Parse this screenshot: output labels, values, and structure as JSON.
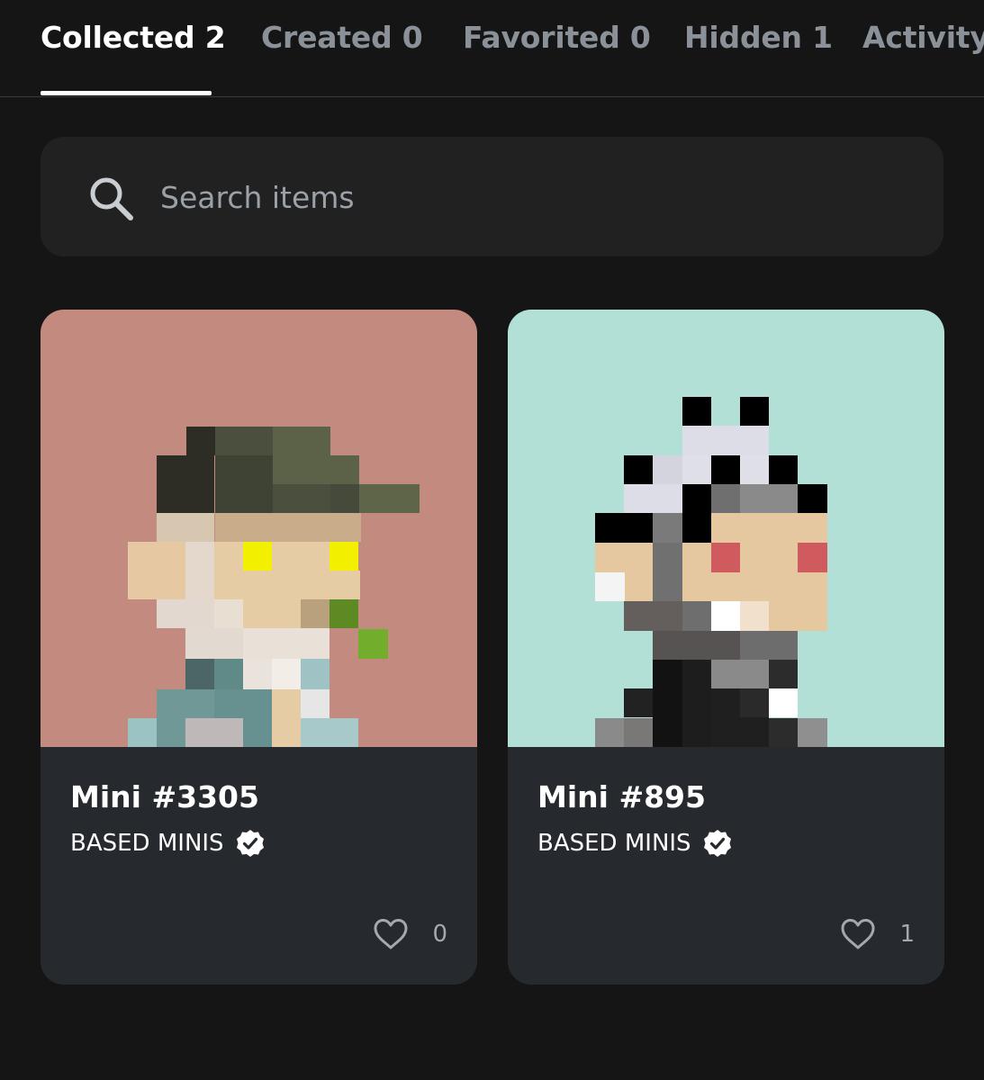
{
  "tabs": [
    {
      "label": "Collected 2",
      "active": true
    },
    {
      "label": "Created 0",
      "active": false
    },
    {
      "label": "Favorited 0",
      "active": false
    },
    {
      "label": "Hidden 1",
      "active": false
    },
    {
      "label": "Activity",
      "active": false
    }
  ],
  "search": {
    "placeholder": "Search items",
    "icon": "search-icon"
  },
  "items": [
    {
      "title": "Mini #3305",
      "collection": "BASED MINIS",
      "verified": true,
      "likes": "0",
      "background": "#c38a80"
    },
    {
      "title": "Mini #895",
      "collection": "BASED MINIS",
      "verified": true,
      "likes": "1",
      "background": "#b2e0d6"
    }
  ],
  "colors": {
    "page_background": "#151515",
    "search_background": "#212121",
    "card_footer": "#262a2f",
    "tab_active": "#ffffff",
    "tab_inactive": "#8a9199"
  }
}
